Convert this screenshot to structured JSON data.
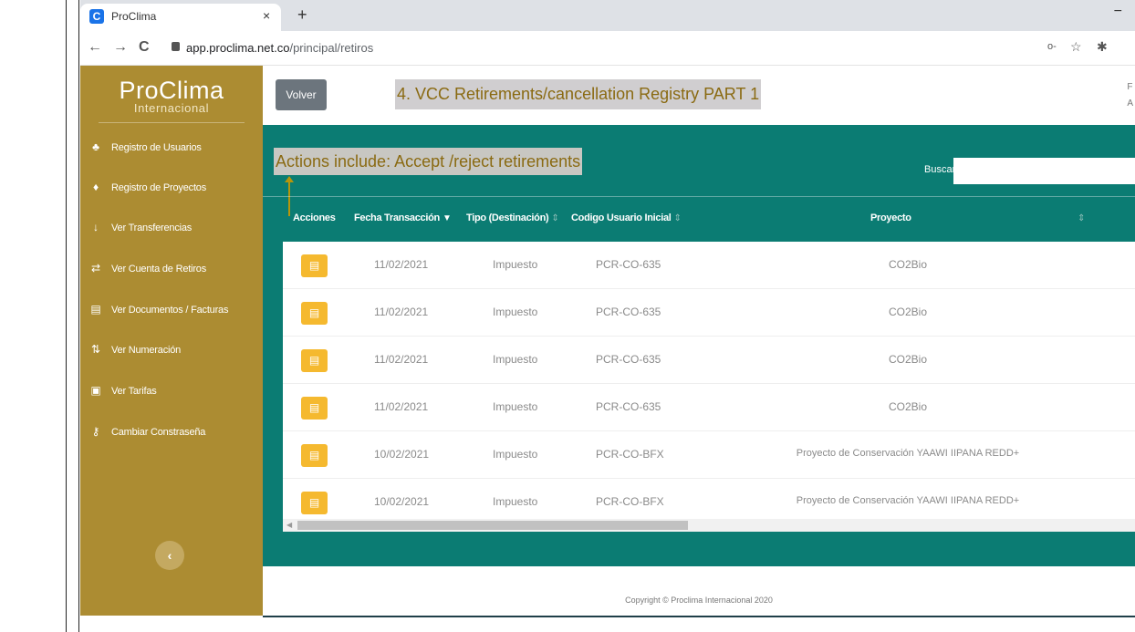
{
  "browser": {
    "tab_title": "ProClima",
    "tab_icon_letter": "C",
    "tab_close": "×",
    "new_tab": "+",
    "minimize": "−",
    "back": "←",
    "forward": "→",
    "reload": "C",
    "url_host": "app.proclima.net.co",
    "url_path": "/principal/retiros",
    "key_icon": "o-",
    "star_icon": "☆",
    "ext_icon": "✱"
  },
  "sidebar": {
    "logo_main": "ProClima",
    "logo_sub": "Internacional",
    "items": [
      {
        "label": "Registro de Usuarios",
        "icon": "users-icon",
        "glyph": "♣"
      },
      {
        "label": "Registro de Proyectos",
        "icon": "hand-icon",
        "glyph": "♦"
      },
      {
        "label": "Ver Transferencias",
        "icon": "arrow-down-icon",
        "glyph": "↓"
      },
      {
        "label": "Ver Cuenta de Retiros",
        "icon": "exchange-icon",
        "glyph": "⇄"
      },
      {
        "label": "Ver Documentos / Facturas",
        "icon": "document-icon",
        "glyph": "▤"
      },
      {
        "label": "Ver Numeración",
        "icon": "sort-icon",
        "glyph": "⇅"
      },
      {
        "label": "Ver Tarifas",
        "icon": "money-icon",
        "glyph": "▣"
      },
      {
        "label": "Cambiar Constraseña",
        "icon": "key-icon",
        "glyph": "⚷"
      }
    ],
    "collapse_glyph": "‹"
  },
  "main": {
    "back_button": "Volver",
    "heading": "4.  VCC Retirements/cancellation Registry PART 1",
    "top_right_line1": "F",
    "top_right_line2": "A",
    "annotation": "Actions include: Accept /reject retirements",
    "search_label": "Buscar",
    "search_value": "",
    "columns": [
      "Acciones",
      "Fecha Transacción",
      "Tipo (Destinación)",
      "Codigo Usuario Inicial",
      "Proyecto"
    ],
    "rows": [
      {
        "fecha": "11/02/2021",
        "tipo": "Impuesto",
        "codigo": "PCR-CO-635",
        "proyecto": "CO2Bio"
      },
      {
        "fecha": "11/02/2021",
        "tipo": "Impuesto",
        "codigo": "PCR-CO-635",
        "proyecto": "CO2Bio"
      },
      {
        "fecha": "11/02/2021",
        "tipo": "Impuesto",
        "codigo": "PCR-CO-635",
        "proyecto": "CO2Bio"
      },
      {
        "fecha": "11/02/2021",
        "tipo": "Impuesto",
        "codigo": "PCR-CO-635",
        "proyecto": "CO2Bio"
      },
      {
        "fecha": "10/02/2021",
        "tipo": "Impuesto",
        "codigo": "PCR-CO-BFX",
        "proyecto": "Proyecto de Conservación YAAWI IIPANA REDD+"
      },
      {
        "fecha": "10/02/2021",
        "tipo": "Impuesto",
        "codigo": "PCR-CO-BFX",
        "proyecto": "Proyecto de Conservación YAAWI IIPANA REDD+"
      }
    ],
    "footer": "Copyright © Proclima Internacional 2020"
  },
  "colors": {
    "sidebar": "#ac8c32",
    "teal": "#0b7c73",
    "action_button": "#f5b92f",
    "back_button": "#6c757d"
  }
}
